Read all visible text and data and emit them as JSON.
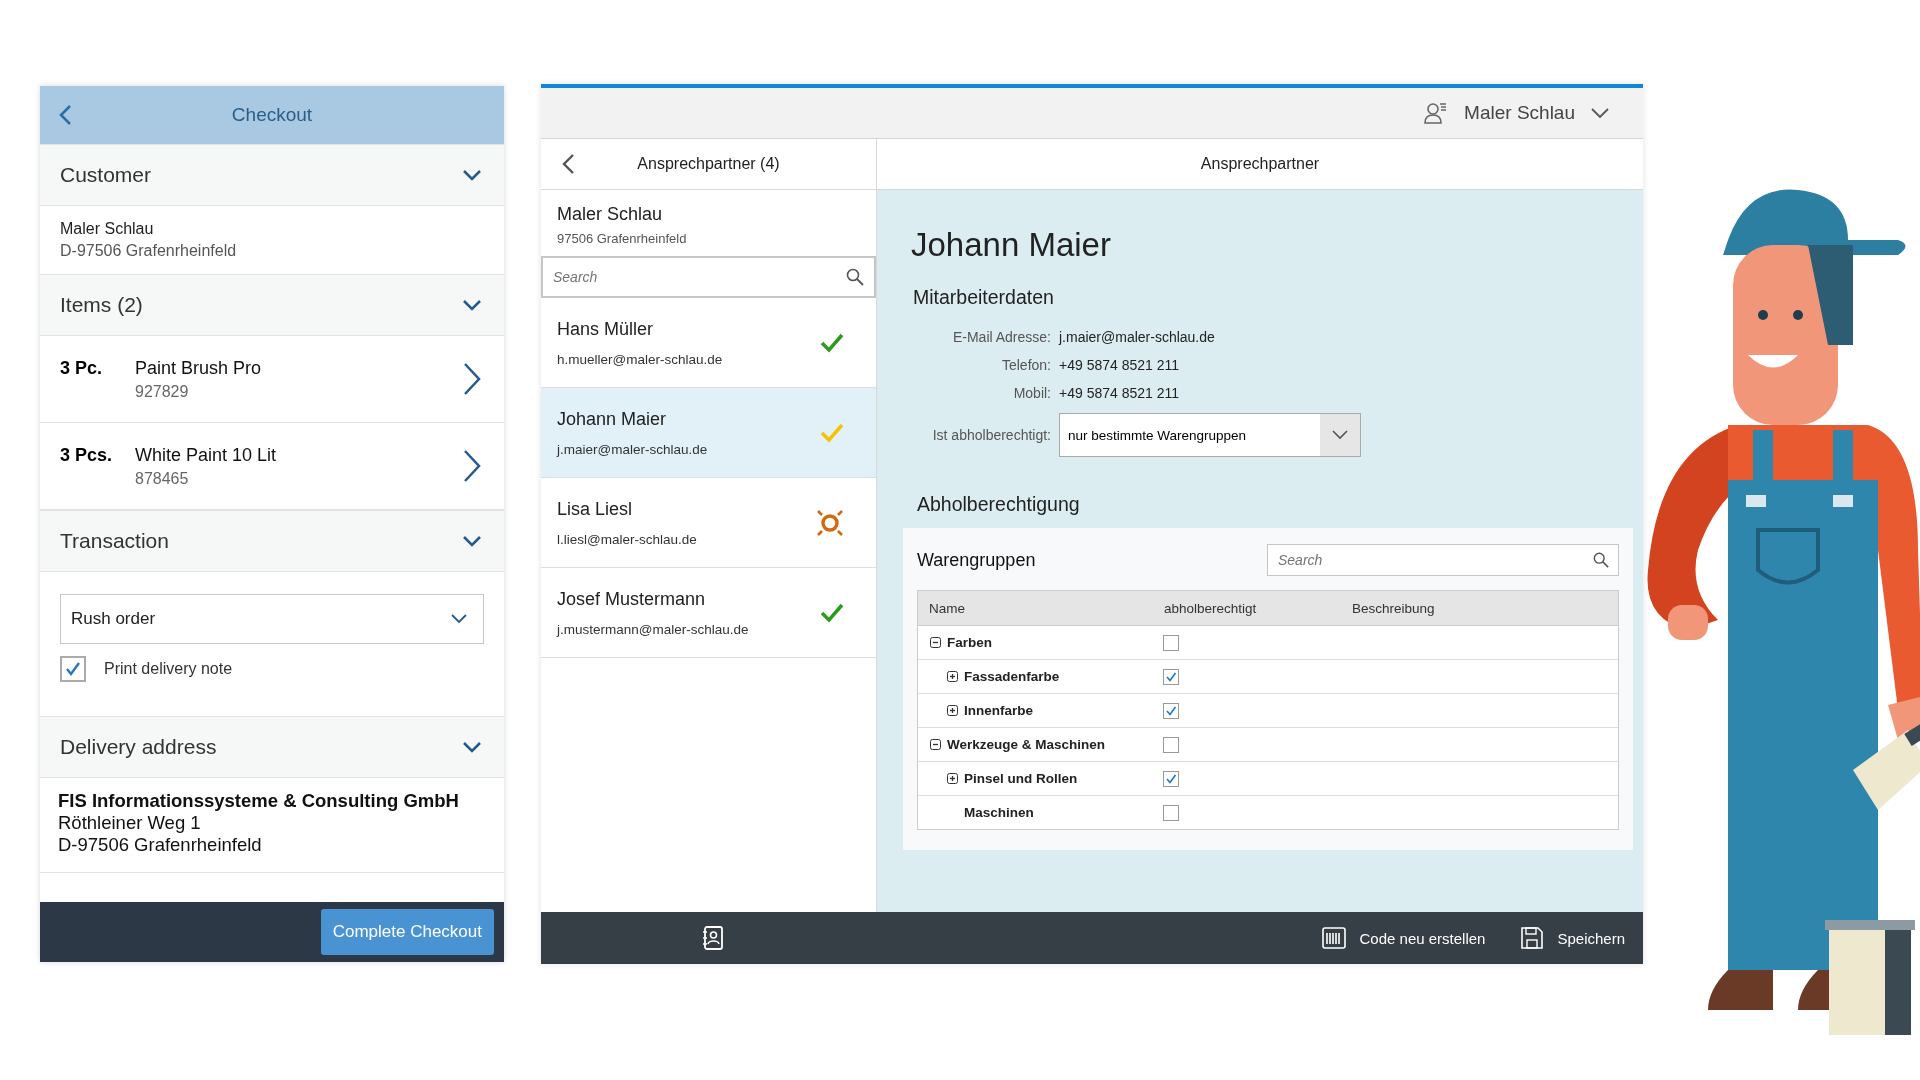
{
  "checkout": {
    "title": "Checkout",
    "customer": {
      "heading": "Customer",
      "name": "Maler Schlau",
      "city": "D-97506 Grafenrheinfeld"
    },
    "items": {
      "heading": "Items (2)",
      "rows": [
        {
          "qty": "3 Pc.",
          "name": "Paint Brush Pro",
          "number": "927829"
        },
        {
          "qty": "3 Pcs.",
          "name": "White Paint 10 Lit",
          "number": "878465"
        }
      ]
    },
    "transaction": {
      "heading": "Transaction",
      "select_value": "Rush order",
      "checkbox": {
        "label": "Print delivery note",
        "checked": true
      }
    },
    "delivery": {
      "heading": "Delivery address",
      "company": "FIS Informationssysteme & Consulting GmbH",
      "lines": [
        "Röthleiner Weg 1",
        "D-97506  Grafenrheinfeld"
      ]
    },
    "button": "Complete Checkout"
  },
  "tablet": {
    "user_menu": "Maler Schlau",
    "master": {
      "title": "Ansprechpartner (4)",
      "customer": {
        "name": "Maler Schlau",
        "city": "97506 Grafenrheinfeld"
      },
      "search_placeholder": "Search",
      "contacts": [
        {
          "name": "Hans Müller",
          "email": "h.mueller@maler-schlau.de",
          "kind": "check",
          "color": "#2b9a1e",
          "selected": false
        },
        {
          "name": "Johann Maier",
          "email": "j.maier@maler-schlau.de",
          "kind": "check",
          "color": "#f5c400",
          "selected": true
        },
        {
          "name": "Lisa Liesl",
          "email": "l.liesl@maler-schlau.de",
          "kind": "alert",
          "color": "#d4680c",
          "selected": false
        },
        {
          "name": "Josef Mustermann",
          "email": "j.mustermann@maler-schlau.de",
          "kind": "check",
          "color": "#2b9a1e",
          "selected": false
        }
      ]
    },
    "detail": {
      "title": "Ansprechpartner",
      "name": "Johann Maier",
      "section_1": "Mitarbeiterdaten",
      "fields": [
        {
          "label": "E-Mail Adresse:",
          "value": "j.maier@maler-schlau.de"
        },
        {
          "label": "Telefon:",
          "value": "+49 5874 8521 211"
        },
        {
          "label": "Mobil:",
          "value": "+49 5874 8521 211"
        }
      ],
      "pickup": {
        "label": "Ist abholberechtigt:",
        "value": "nur bestimmte Warengruppen"
      },
      "section_2": "Abholberechtigung",
      "table": {
        "title": "Warengruppen",
        "search_placeholder": "Search",
        "columns": [
          "Name",
          "abholberechtigt",
          "Beschreibung"
        ],
        "rows": [
          {
            "name": "Farben",
            "expanded": true,
            "checked": false,
            "children": [
              {
                "name": "Fassadenfarbe",
                "expanded": false,
                "checked": true
              },
              {
                "name": "Innenfarbe",
                "expanded": false,
                "checked": true
              }
            ]
          },
          {
            "name": "Werkzeuge & Maschinen",
            "expanded": true,
            "checked": false,
            "children": [
              {
                "name": "Pinsel und Rollen",
                "expanded": false,
                "checked": true
              },
              {
                "name": "Maschinen",
                "checked": false
              }
            ]
          }
        ]
      }
    },
    "footer": {
      "actions": [
        "Code neu erstellen",
        "Speichern"
      ]
    }
  }
}
